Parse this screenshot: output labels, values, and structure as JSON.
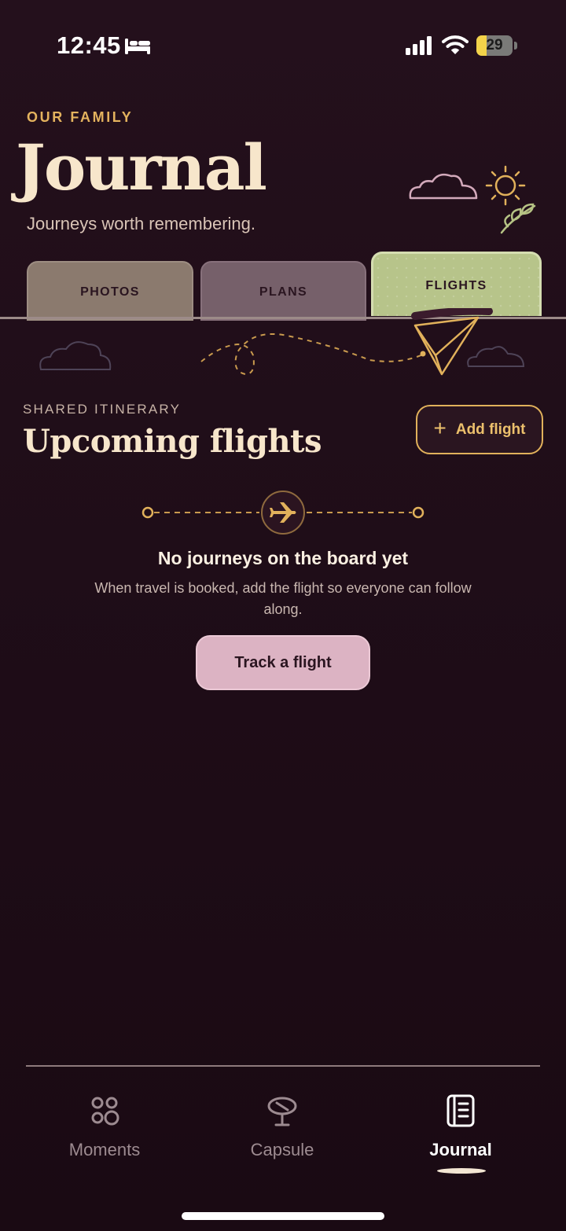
{
  "status_bar": {
    "time": "12:45",
    "battery_level": "29",
    "battery_fraction": 0.29
  },
  "header": {
    "eyebrow": "OUR FAMILY",
    "title": "Journal",
    "subtitle": "Journeys worth remembering."
  },
  "tabs": [
    {
      "label": "PHOTOS",
      "selected": false
    },
    {
      "label": "PLANS",
      "selected": false
    },
    {
      "label": "FLIGHTS",
      "selected": true
    }
  ],
  "section": {
    "eyebrow": "SHARED ITINERARY",
    "title": "Upcoming flights",
    "add_button": {
      "icon": "plus-icon",
      "label": "Add flight"
    }
  },
  "empty_state": {
    "icon": "airplane-icon",
    "title": "No journeys on the board yet",
    "description": "When travel is booked, add the flight so everyone can follow along.",
    "button_label": "Track a flight"
  },
  "bottom_nav": {
    "items": [
      {
        "label": "Moments",
        "icon": "moments-icon",
        "selected": false
      },
      {
        "label": "Capsule",
        "icon": "capsule-icon",
        "selected": false
      },
      {
        "label": "Journal",
        "icon": "journal-icon",
        "selected": true
      }
    ]
  },
  "colors": {
    "background": "#1d0c16",
    "accent_gold": "#e1b15b",
    "title_cream": "#f7e6cb",
    "flights_tab": "#b7c48a",
    "track_button": "#dcb3c3"
  }
}
